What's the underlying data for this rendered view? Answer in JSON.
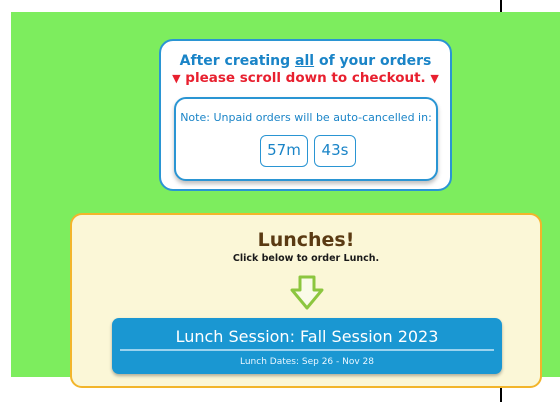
{
  "notice": {
    "line1_pre": "After creating ",
    "line1_em": "all",
    "line1_post": " of your orders",
    "line2_marker_left": "▼",
    "line2_text": "please scroll down to checkout.",
    "line2_marker_right": "▼",
    "timer_note": "Note: Unpaid orders will be auto-cancelled in:",
    "minutes": "57m",
    "seconds": "43s"
  },
  "lunch": {
    "title": "Lunches!",
    "subtitle": "Click below to order Lunch.",
    "arrow_icon": "down-arrow-icon",
    "session_title": "Lunch Session: Fall Session 2023",
    "session_dates": "Lunch Dates: Sep 26 - Nov 28"
  },
  "colors": {
    "page_green": "#7ded5e",
    "accent_blue": "#2a95d3",
    "alert_red": "#e8202f",
    "lunch_bg": "#fbf7d7",
    "lunch_border": "#f2b52b",
    "session_blue": "#1a97d2"
  }
}
